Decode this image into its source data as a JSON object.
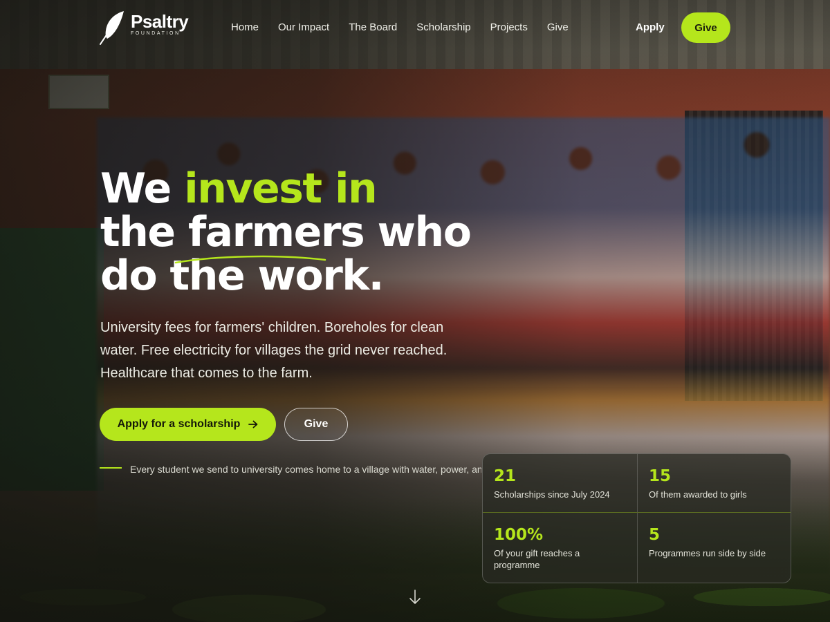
{
  "brand": {
    "name": "Psaltry",
    "subtitle": "FOUNDATION"
  },
  "nav": {
    "items": [
      {
        "label": "Home"
      },
      {
        "label": "Our Impact"
      },
      {
        "label": "The Board"
      },
      {
        "label": "Scholarship"
      },
      {
        "label": "Projects"
      },
      {
        "label": "Give"
      }
    ],
    "apply_label": "Apply",
    "give_label": "Give"
  },
  "hero": {
    "title_part1": "We ",
    "title_accent": "invest in",
    "title_line2": "the farmers who",
    "title_line3": "do the work.",
    "subtitle": "University fees for farmers' children. Boreholes for clean water. Free electricity for villages the grid never reached. Healthcare that comes to the farm.",
    "primary_cta": "Apply for a scholarship",
    "secondary_cta": "Give",
    "tagline": "Every student we send to university comes home to a village with water, power, and care."
  },
  "stats": [
    {
      "value": "21",
      "label": "Scholarships since July 2024"
    },
    {
      "value": "15",
      "label": "Of them awarded to girls"
    },
    {
      "value": "100%",
      "label": "Of your gift reaches a programme"
    },
    {
      "value": "5",
      "label": "Programmes run side by side"
    }
  ],
  "icons": {
    "logo": "feather-icon",
    "cta_arrow": "arrow-right-icon",
    "scroll": "arrow-down-icon"
  },
  "colors": {
    "accent": "#b5e61c",
    "text": "#ffffff",
    "overlay": "#141410"
  }
}
